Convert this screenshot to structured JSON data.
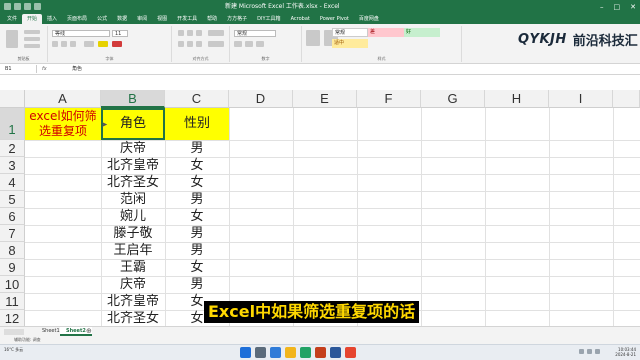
{
  "window": {
    "title": "新建 Microsoft Excel 工作表.xlsx  -  Excel"
  },
  "ribbon_tabs": [
    "文件",
    "开始",
    "插入",
    "页面布局",
    "公式",
    "数据",
    "审阅",
    "视图",
    "开发工具",
    "帮助",
    "方方格子",
    "DIY工具箱",
    "Acrobat",
    "Power Pivot",
    "百度网盘"
  ],
  "ribbon": {
    "font_name": "等线",
    "font_size": "11",
    "number_format": "常规",
    "styles": [
      "常规",
      "差",
      "好",
      "适中"
    ],
    "groups": [
      "剪贴板",
      "字体",
      "对齐方式",
      "数字",
      "样式"
    ]
  },
  "logo": {
    "en": "QYKJH",
    "cn": "前沿科技汇"
  },
  "formula_bar": {
    "name_box": "B1",
    "fx": "fx",
    "value": "角色"
  },
  "grid": {
    "columns": [
      "A",
      "B",
      "C",
      "D",
      "E",
      "F",
      "G",
      "H",
      "I"
    ],
    "rows": [
      "1",
      "2",
      "3",
      "4",
      "5",
      "6",
      "7",
      "8",
      "9",
      "10",
      "11",
      "12"
    ],
    "a1": "excel如何筛选重复项",
    "header_role": "角色",
    "header_gender": "性别",
    "roles": [
      "庆帝",
      "北齐皇帝",
      "北齐圣女",
      "范闲",
      "婉儿",
      "滕子敬",
      "王启年",
      "王霸",
      "庆帝",
      "北齐皇帝",
      "北齐圣女"
    ],
    "genders": [
      "男",
      "女",
      "女",
      "男",
      "女",
      "男",
      "男",
      "女",
      "男",
      "女",
      "女"
    ]
  },
  "subtitle": "Excel中如果筛选重复项的话",
  "sheets": [
    "Sheet1",
    "Sheet2"
  ],
  "status": "辅助功能: 调查",
  "taskbar": {
    "weather": "16°C 多云",
    "time": "10:03:44",
    "date": "2024-8-21"
  },
  "colors": {
    "excel_green": "#217346",
    "highlight_yellow": "#ffff00",
    "title_red": "#d00000",
    "subtitle_yellow": "#ffd800"
  }
}
